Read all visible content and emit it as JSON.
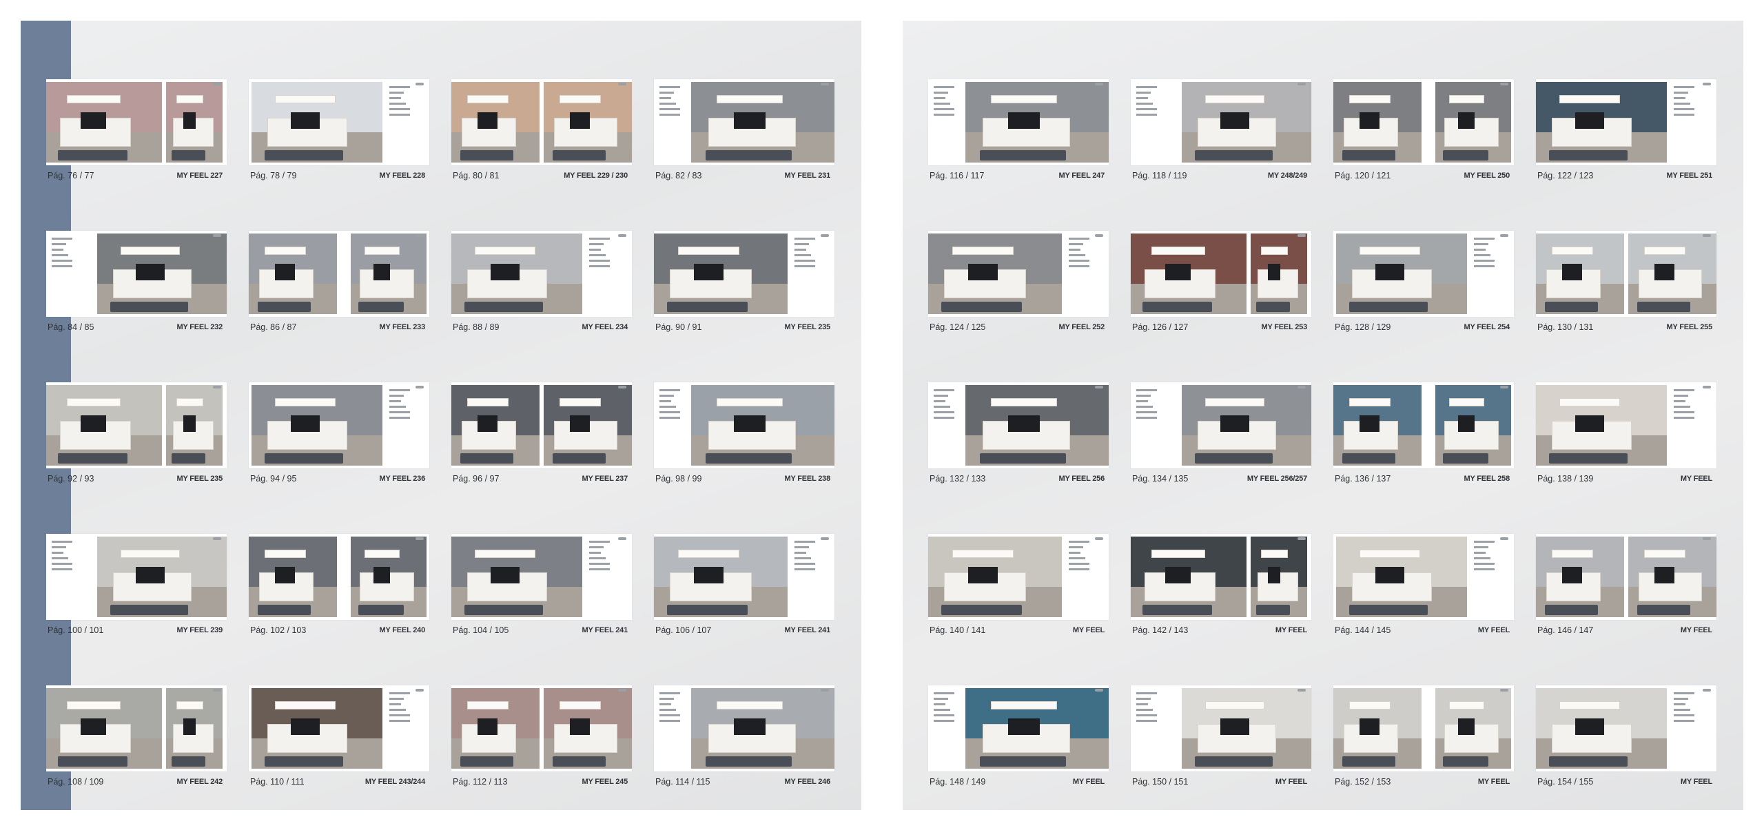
{
  "spreads": [
    {
      "name": "left",
      "sidebar_color": "#6d7f99",
      "pages": [
        {
          "page": "Pág. 76 / 77",
          "model": "MY FEEL 227",
          "wall": "#b79a99"
        },
        {
          "page": "Pág. 78 / 79",
          "model": "MY FEEL 228",
          "wall": "#d8dbe0"
        },
        {
          "page": "Pág. 80 / 81",
          "model": "MY FEEL 229 / 230",
          "wall": "#c9a992"
        },
        {
          "page": "Pág. 82 / 83",
          "model": "MY FEEL 231",
          "wall": "#8c8f94"
        },
        {
          "page": "Pág. 84 / 85",
          "model": "MY FEEL 232",
          "wall": "#7a7d80"
        },
        {
          "page": "Pág. 86 / 87",
          "model": "MY FEEL 233",
          "wall": "#9a9ea4"
        },
        {
          "page": "Pág. 88 / 89",
          "model": "MY FEEL 234",
          "wall": "#b6b8bb"
        },
        {
          "page": "Pág. 90 / 91",
          "model": "MY FEEL 235",
          "wall": "#72757a"
        },
        {
          "page": "Pág. 92 / 93",
          "model": "MY FEEL 235",
          "wall": "#c4c2bd"
        },
        {
          "page": "Pág. 94 / 95",
          "model": "MY FEEL 236",
          "wall": "#8b8f95"
        },
        {
          "page": "Pág. 96 / 97",
          "model": "MY FEEL 237",
          "wall": "#5e6167"
        },
        {
          "page": "Pág. 98 / 99",
          "model": "MY FEEL 238",
          "wall": "#9aa1a8"
        },
        {
          "page": "Pág. 100 / 101",
          "model": "MY FEEL 239",
          "wall": "#c8c6c2"
        },
        {
          "page": "Pág. 102 / 103",
          "model": "MY FEEL 240",
          "wall": "#6c6f75"
        },
        {
          "page": "Pág. 104 / 105",
          "model": "MY FEEL 241",
          "wall": "#7d8086"
        },
        {
          "page": "Pág. 106 / 107",
          "model": "MY FEEL 241",
          "wall": "#b5b8bd"
        },
        {
          "page": "Pág. 108 / 109",
          "model": "MY FEEL 242",
          "wall": "#a9aaa6"
        },
        {
          "page": "Pág. 110 / 111",
          "model": "MY FEEL 243/244",
          "wall": "#6a5d55"
        },
        {
          "page": "Pág. 112 / 113",
          "model": "MY FEEL 245",
          "wall": "#a98f8c"
        },
        {
          "page": "Pág. 114 / 115",
          "model": "MY FEEL 246",
          "wall": "#a8abaf"
        }
      ]
    },
    {
      "name": "right",
      "pages": [
        {
          "page": "Pág. 116 / 117",
          "model": "MY FEEL 247",
          "wall": "#8d9094"
        },
        {
          "page": "Pág. 118 / 119",
          "model": "MY 248/249",
          "wall": "#b3b3b5"
        },
        {
          "page": "Pág. 120 / 121",
          "model": "MY FEEL 250",
          "wall": "#7e7f82"
        },
        {
          "page": "Pág. 122 / 123",
          "model": "MY FEEL 251",
          "wall": "#445868"
        },
        {
          "page": "Pág. 124 / 125",
          "model": "MY FEEL 252",
          "wall": "#8a8c8f"
        },
        {
          "page": "Pág. 126 / 127",
          "model": "MY FEEL 253",
          "wall": "#7a4f48"
        },
        {
          "page": "Pág. 128 / 129",
          "model": "MY FEEL 254",
          "wall": "#a4a7aa"
        },
        {
          "page": "Pág. 130 / 131",
          "model": "MY FEEL 255",
          "wall": "#c2c5c8"
        },
        {
          "page": "Pág. 132 / 133",
          "model": "MY FEEL 256",
          "wall": "#66696d"
        },
        {
          "page": "Pág. 134 / 135",
          "model": "MY FEEL 256/257",
          "wall": "#8e9195"
        },
        {
          "page": "Pág. 136 / 137",
          "model": "MY FEEL 258",
          "wall": "#56748a"
        },
        {
          "page": "Pág. 138 / 139",
          "model": "MY FEEL",
          "wall": "#d7d3cc"
        },
        {
          "page": "Pág. 140 / 141",
          "model": "MY FEEL",
          "wall": "#c9c6c0"
        },
        {
          "page": "Pág. 142 / 143",
          "model": "MY FEEL",
          "wall": "#3f4548"
        },
        {
          "page": "Pág. 144 / 145",
          "model": "MY FEEL",
          "wall": "#d3d0ca"
        },
        {
          "page": "Pág. 146 / 147",
          "model": "MY FEEL",
          "wall": "#b3b5b8"
        },
        {
          "page": "Pág. 148 / 149",
          "model": "MY FEEL",
          "wall": "#3e6f86"
        },
        {
          "page": "Pág. 150 / 151",
          "model": "MY FEEL",
          "wall": "#dcdad6"
        },
        {
          "page": "Pág. 152 / 153",
          "model": "MY FEEL",
          "wall": "#cfcdca"
        },
        {
          "page": "Pág. 154 / 155",
          "model": "MY FEEL",
          "wall": "#d6d4d0"
        }
      ]
    }
  ]
}
